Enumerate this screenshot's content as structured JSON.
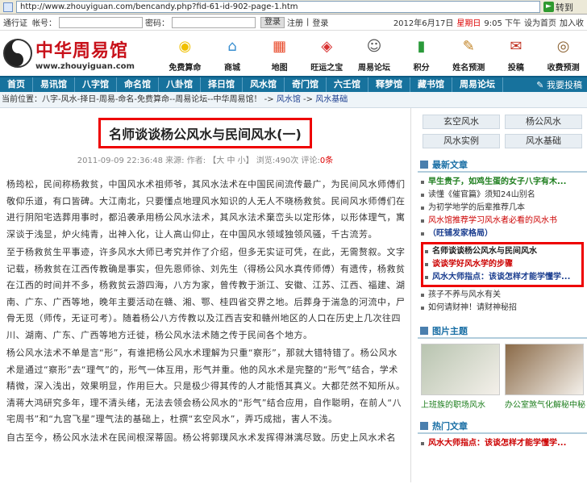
{
  "browser": {
    "url": "http://www.zhouyiguan.com/bencandy.php?fid-61-id-902-page-1.htm",
    "go_label": "转到"
  },
  "loginbar": {
    "pass_label": "通行证",
    "account_label": "帐号：",
    "password_label": "密码：",
    "login_button": "登录",
    "register_link": "注册",
    "login_link": "登录",
    "date": "2012年6月17日",
    "weekday": "星期日",
    "time": "9:05 下午",
    "homepage_link": "设为首页",
    "fav_link": "加入收"
  },
  "logo": {
    "name": "中华周易馆",
    "domain": "www.zhouyiguan.com"
  },
  "topnav": [
    {
      "label": "免费算命",
      "icon": "money-bag-icon",
      "color": "#f0c000"
    },
    {
      "label": "商城",
      "icon": "house-icon",
      "color": "#3a8fd0"
    },
    {
      "label": "地图",
      "icon": "blocks-icon",
      "color": "#e84a2a"
    },
    {
      "label": "旺运之宝",
      "icon": "lantern-icon",
      "color": "#d83030"
    },
    {
      "label": "周易论坛",
      "icon": "people-icon",
      "color": "#555555"
    },
    {
      "label": "积分",
      "icon": "chart-icon",
      "color": "#2a9a3a"
    },
    {
      "label": "姓名预测",
      "icon": "pencil-icon",
      "color": "#c08020"
    },
    {
      "label": "投稿",
      "icon": "envelope-icon",
      "color": "#c03020"
    },
    {
      "label": "收费预测",
      "icon": "compass-icon",
      "color": "#8a6030"
    }
  ],
  "mainnav": [
    "首页",
    "易讯馆",
    "八字馆",
    "命名馆",
    "八卦馆",
    "择日馆",
    "风水馆",
    "奇门馆",
    "六壬馆",
    "释梦馆",
    "藏书馆",
    "周易论坛"
  ],
  "mainnav_post": "我要投稿",
  "breadcrumb": {
    "prefix": "当前位置：八字-风水-择日-周易-命名-免费算命--周易论坛--中华周易馆！",
    "sep1": " -> ",
    "section": "风水馆",
    "sep2": " -> ",
    "sub": "风水基础"
  },
  "article": {
    "title": "名师谈谈杨公风水与民间风水(一)",
    "date": "2011-09-09 22:36:48",
    "source_label": "来源:",
    "author_label": "作者:",
    "font_label": "【大 中 小】",
    "views_label": "浏览:",
    "views": "490次",
    "comments_label": "评论:",
    "comments": "0条",
    "paragraphs": [
      "杨筠松，民间称杨救贫，中国风水术祖师爷，其风水法术在中国民间流传最广，为民间风水师傅们敬仰乐道，有口皆碑。大江南北，只要懂点地理风水知识的人无人不晓杨救贫。民间风水师傅们在进行阴阳宅选葬用事时，都沿袭承用杨公风水法术，其风水法术棄峦头以定形体，以形体理气，寓深谈于浅显，炉火纯青，出神入化，让人高山仰止，在中国风水领域独领风骚，千古流芳。",
      "至于杨救贫生平事迹，许多风水大师已考究并作了介绍，但多无实证可凭，在此，无需赘叙。文字记载，杨救贫在江西传教确是事实，但先恩师徐、刘先生（得杨公风水真传师傅）有遗传，杨救贫在江西的时间并不多，杨救贫云游四海，八方为家，曾传教于浙江、安徽、江苏、江西、福建、湖南、广东、广西等地，晚年主要活动在赣、湘、鄂、桂四省交界之地。后葬身于湍急的河流中，尸骨无觅（师传，无证可考）。随着杨公八方传教以及江西吉安和赣州地区的人口在历史上几次往四川、湖南、广东、广西等地方迁徙，杨公风水法术随之传于民间各个地方。",
      "杨公风水法术不单是言“形”，有谁把杨公风水术理解为只重“察形”，那就大错特错了。杨公风水术是通过“察形”去“理气”的，形气一体互用，形气并重。他的风水术是完整的“形气”结合，学术精微，深入浅出，效果明显，作用巨大。只是极少得其传的人才能悟其真义。大都茫然不知所从。清蒋大鸿研究多年，理不清头绪，无法去领会杨公风水的“形气”结合应用，自作聪明，在前人“八宅周书”和“九宫飞星”理气法的基础上，杜撰“玄空风水”，弄巧成拙，害人不浅。",
      "自古至今，杨公风水法术在民间根深蒂固。杨公将郭璞风水术发挥得淋漓尽致。历史上风水术名"
    ]
  },
  "sidebar": {
    "tags": [
      "玄空风水",
      "杨公风水",
      "风水实例",
      "风水基础"
    ],
    "latest_title": "最新文章",
    "latest": [
      {
        "text": "早生贵子，如鸡生蛋的女子八字有木...",
        "style": "green"
      },
      {
        "text": "读懂《催官篇》须知24山别名",
        "style": "normal"
      },
      {
        "text": "为初学地学的后辈推荐几本",
        "style": "normal"
      },
      {
        "text": "风水馆推荐学习风水者必看的风水书",
        "style": "redlink"
      },
      {
        "text": "（旺铺发家格局）",
        "style": "bluebold"
      }
    ],
    "highlighted": [
      {
        "text": "名师谈谈杨公风水与民间风水",
        "style": "bold"
      },
      {
        "text": "谈谈学好风水学的步骤",
        "style": "redlink-bold"
      },
      {
        "text": "风水大师指点：该谈怎样才能学懂学...",
        "style": "bluebold"
      }
    ],
    "latest_more": [
      {
        "text": "孩子不养与风水有关",
        "style": "normal"
      },
      {
        "text": "如何请财神！请财神秘招",
        "style": "normal"
      }
    ],
    "pics_title": "图片主题",
    "pics": [
      {
        "caption": "上班族的职场风水",
        "color": "#b8c4b0"
      },
      {
        "caption": "办公室煞气化解秘中秘",
        "color": "#8a6a48"
      }
    ],
    "hot_title": "热门文章",
    "hot": [
      {
        "text": "风水大师指点：该谈怎样才能学懂学...",
        "style": "redlink-bold"
      }
    ]
  }
}
